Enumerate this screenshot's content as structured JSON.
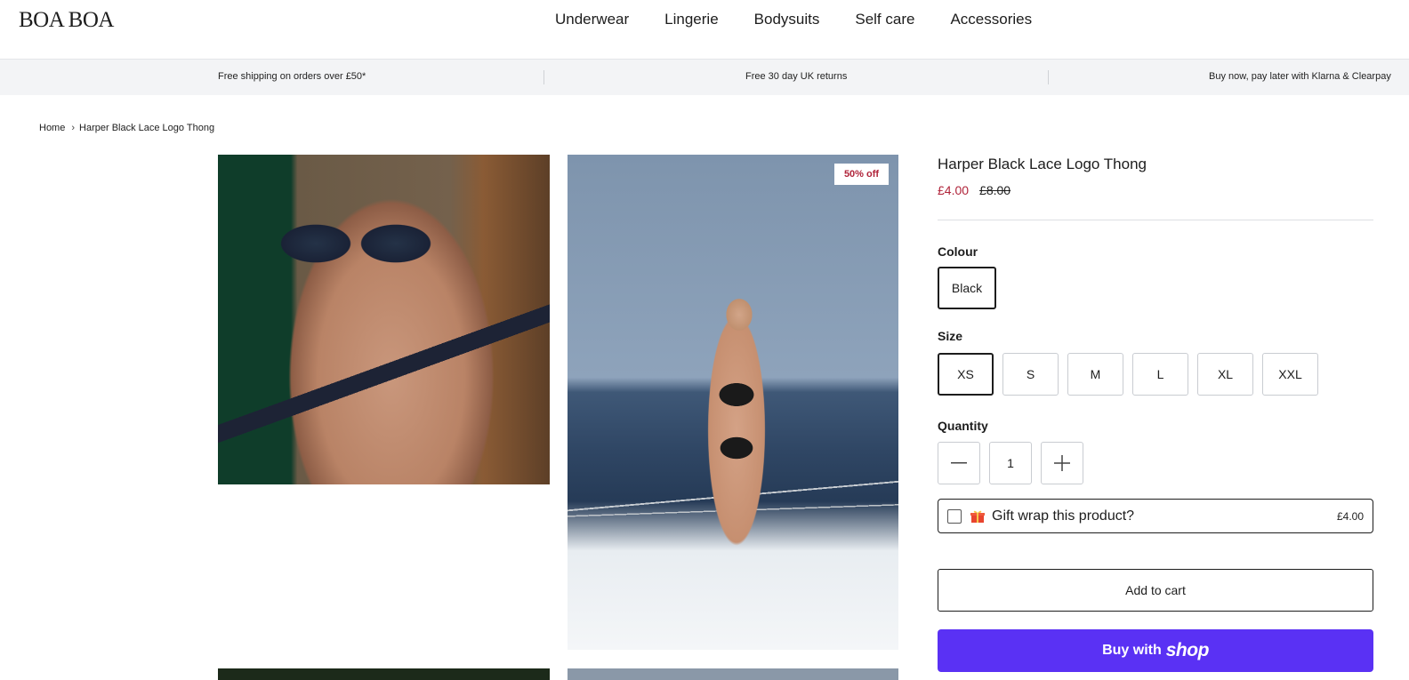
{
  "header": {
    "logo": "BOA BOA",
    "nav": [
      "Underwear",
      "Lingerie",
      "Bodysuits",
      "Self care",
      "Accessories"
    ]
  },
  "announcements": [
    "Free shipping on orders over £50*",
    "Free 30 day UK returns",
    "Buy now, pay later with Klarna & Clearpay"
  ],
  "breadcrumb": {
    "home": "Home",
    "current": "Harper Black Lace Logo Thong"
  },
  "gallery": {
    "badge": "50% off"
  },
  "product": {
    "title": "Harper Black Lace Logo Thong",
    "sale_price": "£4.00",
    "original_price": "£8.00",
    "colour_label": "Colour",
    "colours": [
      "Black"
    ],
    "selected_colour": "Black",
    "size_label": "Size",
    "sizes": [
      "XS",
      "S",
      "M",
      "L",
      "XL",
      "XXL"
    ],
    "selected_size": "XS",
    "quantity_label": "Quantity",
    "quantity": "1",
    "gift_wrap": {
      "label": "Gift wrap this product?",
      "price": "£4.00",
      "checked": false
    },
    "add_to_cart": "Add to cart",
    "shop_pay": {
      "prefix": "Buy with",
      "brand": "shop",
      "color": "#5a31f4"
    }
  },
  "colors": {
    "sale": "#b0243a",
    "accent_shop": "#5a31f4"
  }
}
